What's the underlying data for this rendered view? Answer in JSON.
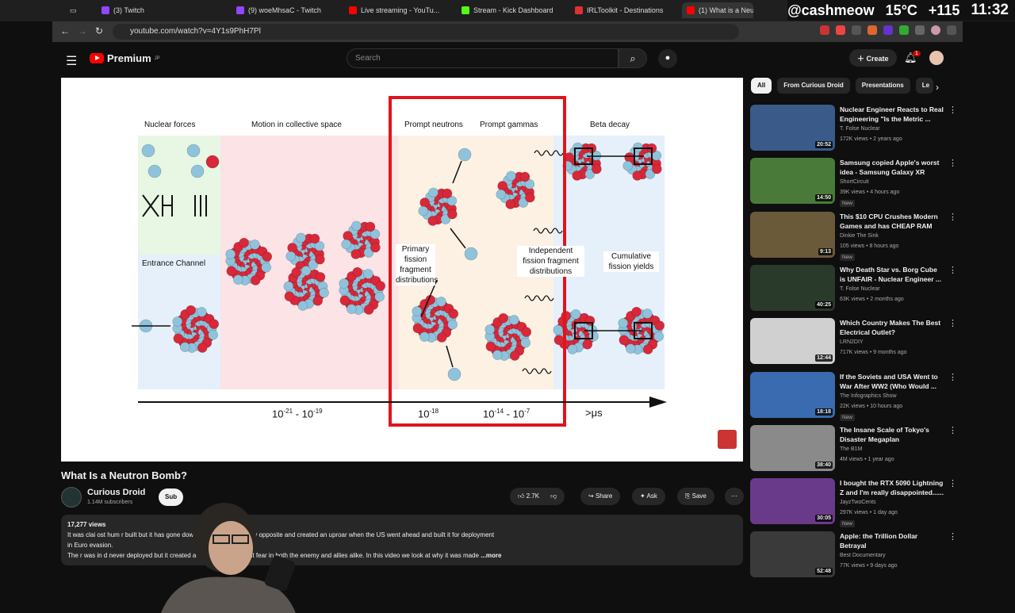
{
  "tabs": [
    {
      "label": "(3) Twitch",
      "color": "#9146ff"
    },
    {
      "label": "(9) woeMhsaC - Twitch",
      "color": "#9146ff"
    },
    {
      "label": "Live streaming - YouTu...",
      "color": "#ff0000"
    },
    {
      "label": "Stream - Kick Dashboard",
      "color": "#53fc18"
    },
    {
      "label": "IRLToolkit - Destinations",
      "color": "#e03030"
    },
    {
      "label": "(1) What is a Neutr...",
      "color": "#ff0000"
    }
  ],
  "overlay": {
    "handle": "@cashmeow",
    "temp": "15°C",
    "count": "+115",
    "time": "11:32"
  },
  "url": "youtube.com/watch?v=4Y1s9PhH7Pl",
  "header": {
    "brand": "Premium",
    "region": "JP",
    "search_placeholder": "Search",
    "create_label": "Create",
    "notif_count": "1"
  },
  "diagram": {
    "sections": {
      "nuclear_forces": "Nuclear forces",
      "collective": "Motion in collective space",
      "prompt_neutrons": "Prompt neutrons",
      "prompt_gammas": "Prompt gammas",
      "beta": "Beta decay",
      "entrance": "Entrance Channel",
      "primary": "Primary fission fragment distributions",
      "independent": "Independent fission fragment distributions",
      "cumulative": "Cumulative fission yields"
    },
    "timeline": {
      "t1": "10",
      "t1e": "-21",
      "t2": "10",
      "t2e": "-19",
      "t3": "10",
      "t3e": "-18",
      "t4": "10",
      "t4e": "-14",
      "t5": "10",
      "t5e": "-7",
      "t6": ">μs"
    }
  },
  "video": {
    "title": "What Is a Neutron Bomb?",
    "channel": "Curious Droid",
    "subscribers": "1.14M subscribers",
    "subscribe_label": "Sub",
    "likes": "2.7K",
    "share_label": "Share",
    "ask_label": "Ask",
    "save_label": "Save",
    "views": "17,277 views",
    "desc_line1": "It was clai                                                ost hum                r built  but it has gone down in history as the very opposite and created an uproar when the US  went ahead and built it for deployment",
    "desc_line2": "in Euro                                                    evasion.",
    "desc_line3": "The r                                                     was in             d never deployed but it created a tremendous amount fear in both the enemy and allies alike. In this video we look at why it was made",
    "more_label": "...more"
  },
  "chips": [
    "All",
    "From Curious Droid",
    "Presentations",
    "Le"
  ],
  "recommendations": [
    {
      "title": "Nuclear Engineer Reacts to Real Engineering \"Is the Metric ...",
      "channel": "T. Folse Nuclear",
      "meta": "172K views • 2 years ago",
      "duration": "20:52",
      "new": "",
      "thumb": "#3a5a8a"
    },
    {
      "title": "Samsung copied Apple's worst idea - Samsung Galaxy XR",
      "channel": "ShortCircuit",
      "meta": "39K views • 4 hours ago",
      "duration": "14:50",
      "new": "New",
      "thumb": "#4a7a3a"
    },
    {
      "title": "This $10 CPU Crushes Modern Games and has CHEAP RAM",
      "channel": "Dinkie The Sink",
      "meta": "105 views • 8 hours ago",
      "duration": "9:13",
      "new": "New",
      "thumb": "#6a5a3a"
    },
    {
      "title": "Why Death Star vs. Borg Cube is UNFAIR - Nuclear Engineer ...",
      "channel": "T. Folse Nuclear",
      "meta": "63K views • 2 months ago",
      "duration": "40:25",
      "new": "",
      "thumb": "#2a3a2a"
    },
    {
      "title": "Which Country Makes The Best Electrical Outlet?",
      "channel": "LRN2DIY",
      "meta": "717K views • 9 months ago",
      "duration": "12:44",
      "new": "",
      "thumb": "#d0d0d0"
    },
    {
      "title": "If the Soviets and USA Went to War After WW2 (Who Would ...",
      "channel": "The Infographics Show",
      "meta": "22K views • 10 hours ago",
      "duration": "18:18",
      "new": "New",
      "thumb": "#3a6ab0"
    },
    {
      "title": "The Insane Scale of Tokyo's Disaster Megaplan",
      "channel": "The B1M",
      "meta": "4M views • 1 year ago",
      "duration": "38:40",
      "new": "",
      "thumb": "#8a8a8a"
    },
    {
      "title": "I bought the RTX 5090 Lightning Z and I'm really disappointed......",
      "channel": "JayzTwoCents",
      "meta": "297K views • 1 day ago",
      "duration": "30:05",
      "new": "New",
      "thumb": "#6a3a8a"
    },
    {
      "title": "Apple: the Trillion Dollar Betrayal",
      "channel": "Best Documentary",
      "meta": "77K views • 9 days ago",
      "duration": "52:48",
      "new": "",
      "thumb": "#3a3a3a"
    }
  ],
  "colors": {
    "red_frame": "#e0141c",
    "proton": "#d8283a",
    "neutron": "#8fc3dc",
    "bg_green": "#e7f7e3",
    "bg_pink": "#fce3e6",
    "bg_peach": "#fdf1e3",
    "bg_blue": "#e5f0fb"
  }
}
